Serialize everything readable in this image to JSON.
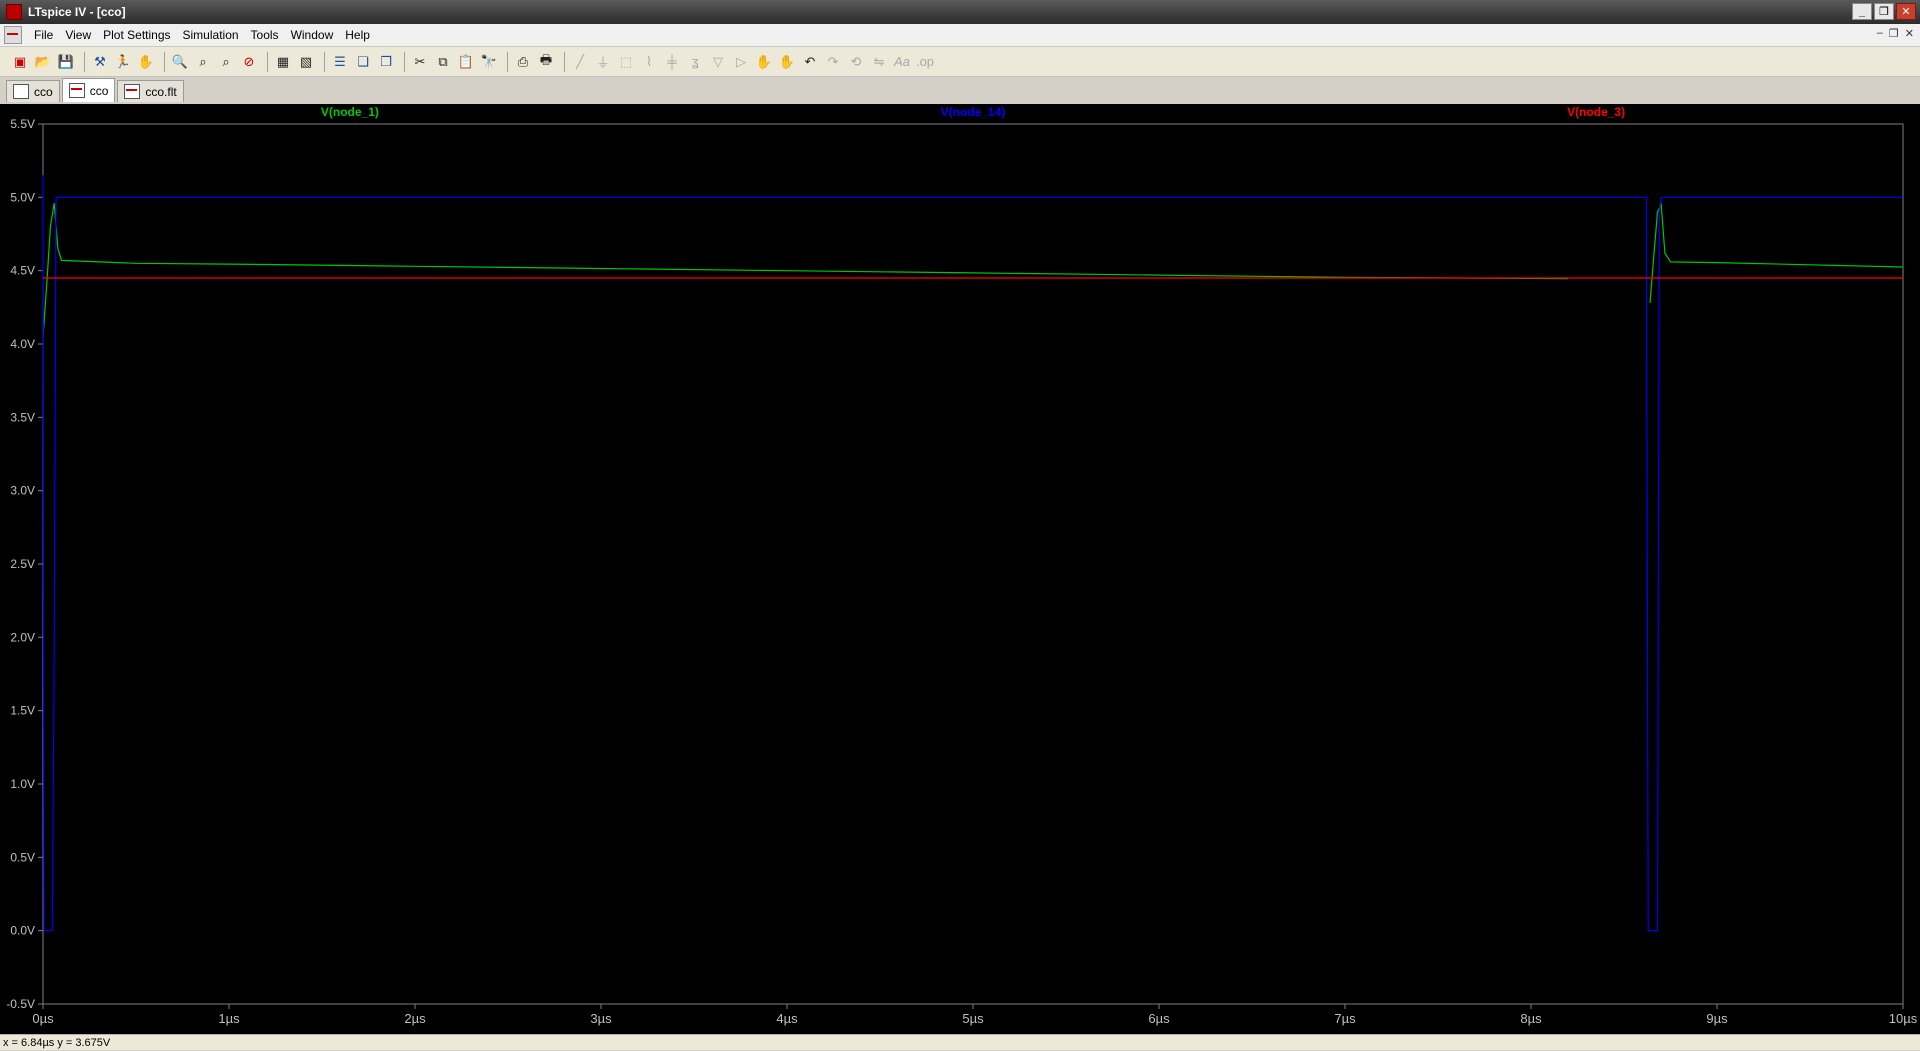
{
  "window": {
    "title": "LTspice IV - [cco]",
    "controls": [
      "minimize",
      "restore",
      "close"
    ]
  },
  "menu": [
    "File",
    "View",
    "Plot Settings",
    "Simulation",
    "Tools",
    "Window",
    "Help"
  ],
  "toolbar": {
    "icons": [
      "new-schematic-icon",
      "open-icon",
      "save-icon",
      "control-panel-icon",
      "run-icon",
      "halt-icon",
      "zoom-in-icon",
      "zoom-fit-icon",
      "zoom-out-icon",
      "zoom-reset-icon",
      "autorange-icon",
      "delete-trace-icon",
      "tile-horizontal-icon",
      "cascade-icon",
      "tile-vertical-icon",
      "cut-icon",
      "copy-icon",
      "paste-icon",
      "find-icon",
      "print-preview-icon",
      "print-icon",
      "wire-icon",
      "ground-icon",
      "label-icon",
      "resistor-icon",
      "capacitor-icon",
      "inductor-icon",
      "diode-icon",
      "component-icon",
      "move-icon",
      "drag-icon",
      "undo-icon",
      "redo-icon",
      "rotate-icon",
      "mirror-icon",
      "text-icon",
      "spice-directive-icon"
    ]
  },
  "tabs": [
    {
      "label": "cco",
      "icon": "schematic-icon"
    },
    {
      "label": "cco",
      "icon": "waveform-icon"
    },
    {
      "label": "cco.flt",
      "icon": "waveform-icon"
    }
  ],
  "status": {
    "readout": "x = 6.84µs    y = 3.675V"
  },
  "colors": {
    "node_1": "#00c800",
    "node_14": "#0000ff",
    "node_3": "#ff0000",
    "background": "#000000",
    "axis": "#808080"
  },
  "chart_data": {
    "type": "line",
    "title": "",
    "xlabel": "",
    "ylabel": "",
    "xlim": [
      0,
      10
    ],
    "ylim": [
      -0.5,
      5.5
    ],
    "x_unit": "µs",
    "x_ticks": [
      "0µs",
      "1µs",
      "2µs",
      "3µs",
      "4µs",
      "5µs",
      "6µs",
      "7µs",
      "8µs",
      "9µs",
      "10µs"
    ],
    "y_ticks": [
      "5.5V",
      "5.0V",
      "4.5V",
      "4.0V",
      "3.5V",
      "3.0V",
      "2.5V",
      "2.0V",
      "1.5V",
      "1.0V",
      "0.5V",
      "0.0V",
      "-0.5V"
    ],
    "grid": false,
    "legend": "top",
    "series": [
      {
        "name": "V(node_1)",
        "color": "#00c800",
        "points": [
          [
            0.0,
            4.05
          ],
          [
            0.02,
            4.4
          ],
          [
            0.04,
            4.8
          ],
          [
            0.06,
            4.96
          ],
          [
            0.08,
            4.65
          ],
          [
            0.1,
            4.57
          ],
          [
            0.5,
            4.55
          ],
          [
            1,
            4.545
          ],
          [
            2,
            4.53
          ],
          [
            3,
            4.515
          ],
          [
            4,
            4.5
          ],
          [
            5,
            4.485
          ],
          [
            6,
            4.47
          ],
          [
            7,
            4.455
          ],
          [
            8.2,
            4.445
          ],
          null,
          [
            8.64,
            4.28
          ],
          [
            8.66,
            4.6
          ],
          [
            8.68,
            4.9
          ],
          [
            8.7,
            4.95
          ],
          [
            8.72,
            4.62
          ],
          [
            8.75,
            4.56
          ],
          [
            9,
            4.555
          ],
          [
            10,
            4.525
          ]
        ]
      },
      {
        "name": "V(node_14)",
        "color": "#0000ff",
        "points": [
          [
            0.0,
            5.15
          ],
          [
            0.005,
            0.0
          ],
          [
            0.05,
            0.0
          ],
          [
            0.06,
            1.9
          ],
          [
            0.07,
            5.0
          ],
          [
            8.62,
            5.0
          ],
          [
            8.63,
            0.0
          ],
          [
            8.68,
            0.0
          ],
          [
            8.69,
            4.9
          ],
          [
            8.7,
            5.0
          ],
          [
            10,
            5.0
          ]
        ]
      },
      {
        "name": "V(node_3)",
        "color": "#ff0000",
        "points": [
          [
            0,
            4.45
          ],
          [
            10,
            4.45
          ]
        ]
      }
    ]
  }
}
